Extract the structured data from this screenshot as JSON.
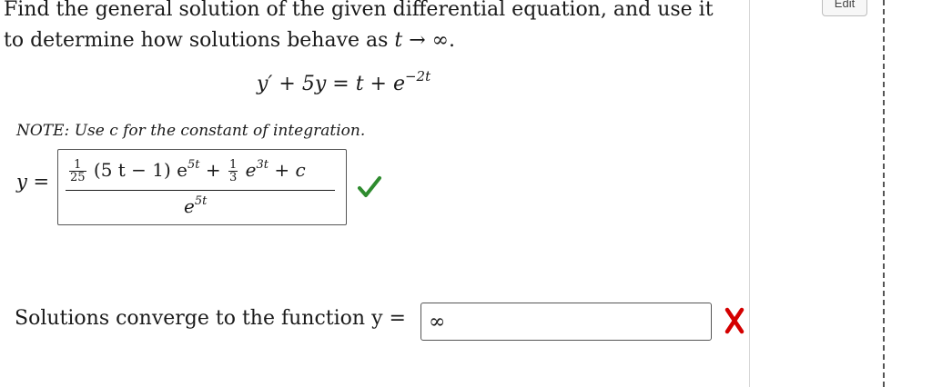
{
  "question": {
    "line1": "Find the general solution of the given differential equation, and use it",
    "line2_prefix": "to determine how solutions behave as ",
    "line2_var": "t",
    "line2_arrow": " → ∞."
  },
  "equation": {
    "lhs": "y′ + 5y = t + e",
    "exponent": "−2t"
  },
  "note": "NOTE: Use c for the constant of integration.",
  "answer1": {
    "label": "y =",
    "frac_num": "1",
    "frac_den": "25",
    "term1": "(5 t − 1) e",
    "exp1": "5t",
    "plus": "+",
    "frac2_num": "1",
    "frac2_den": "3",
    "term2": "e",
    "exp2": "3t",
    "term3": "+ c",
    "denominator": "e",
    "den_exp": "5t",
    "status": "correct"
  },
  "answer2": {
    "prompt": "Solutions converge to the function y =",
    "value": "∞",
    "status": "incorrect"
  },
  "sidebar": {
    "edit_label": "Edit"
  },
  "colors": {
    "correct": "#2e8b2e",
    "incorrect": "#d40000"
  }
}
